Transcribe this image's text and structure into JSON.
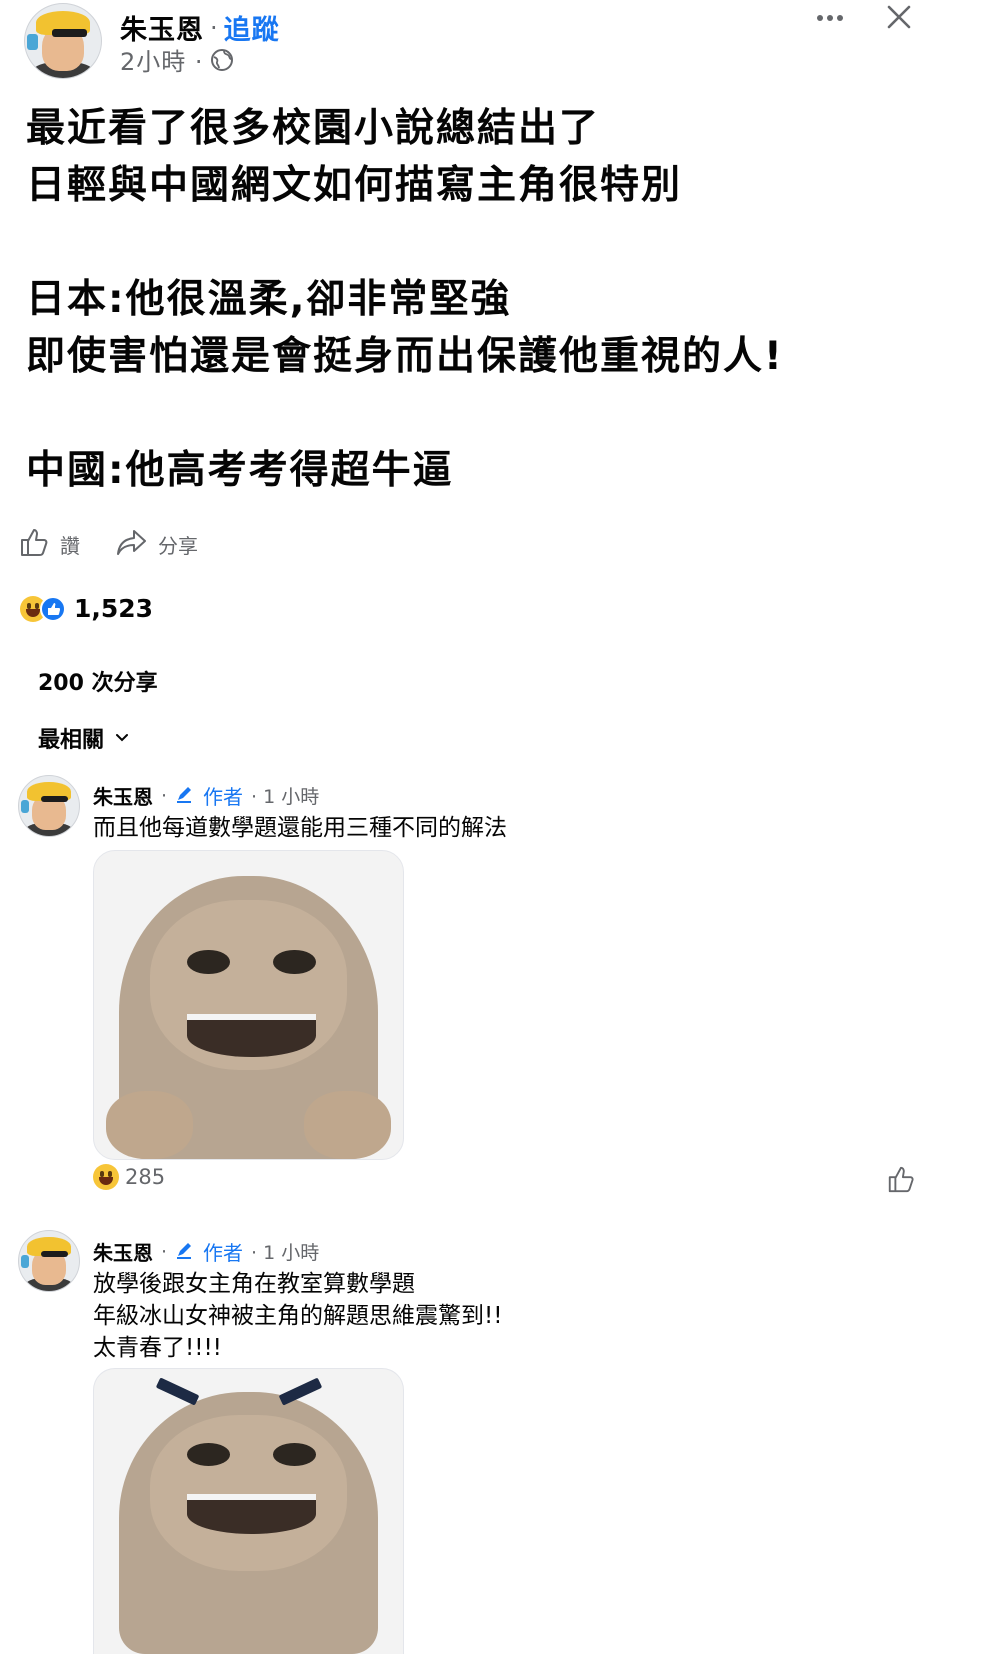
{
  "post": {
    "author": "朱玉恩",
    "separator": "·",
    "follow_label": "追蹤",
    "time": "2小時 ·",
    "icons": {
      "privacy": "globe-icon",
      "more": "more-icon",
      "close": "close-icon"
    },
    "body": "最近看了很多校園小說總結出了\n日輕與中國網文如何描寫主角很特別\n\n日本:他很溫柔,卻非常堅強\n即使害怕還是會挺身而出保護他重視的人!\n\n中國:他高考考得超牛逼",
    "actions": {
      "like_label": "讚",
      "share_label": "分享"
    },
    "reaction_count": "1,523",
    "shares_label": "200 次分享",
    "sort_label": "最相關"
  },
  "comments": [
    {
      "name": "朱玉恩",
      "dot": "·",
      "author_badge": "作者",
      "time": "· 1 小時",
      "text": "而且他每道數學題還能用三種不同的解法",
      "reaction_count": "285"
    },
    {
      "name": "朱玉恩",
      "dot": "·",
      "author_badge": "作者",
      "time": "· 1 小時",
      "text": "放學後跟女主角在教室算數學題\n年級冰山女神被主角的解題思維震驚到!!\n太青春了!!!!"
    }
  ],
  "colors": {
    "accent": "#1877f2",
    "secondary_text": "#65676b",
    "text": "#050505"
  }
}
